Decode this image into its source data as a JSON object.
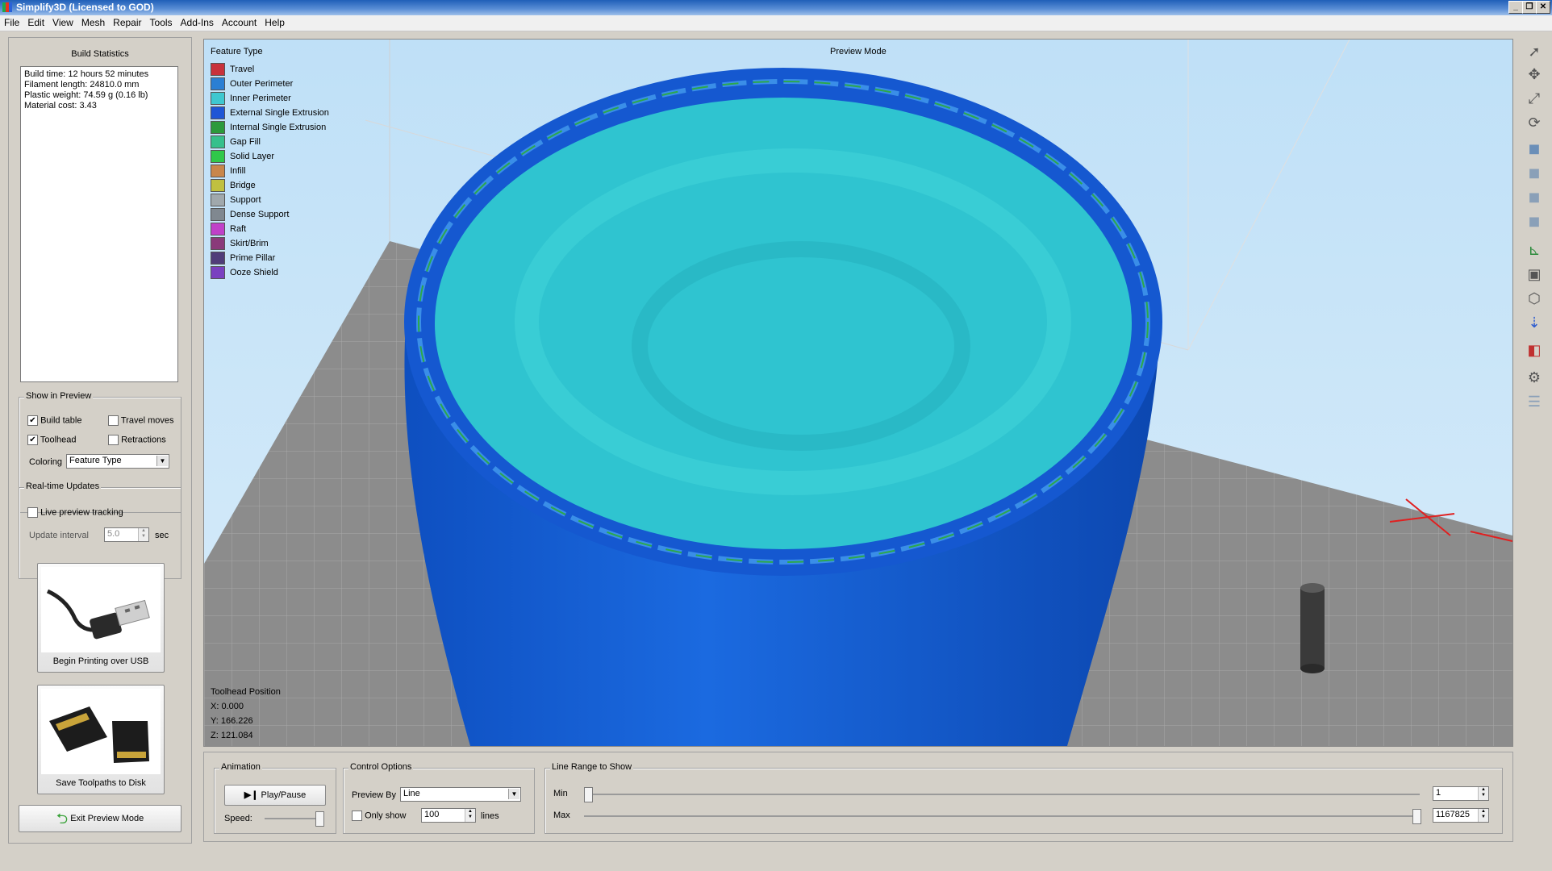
{
  "window": {
    "title": "Simplify3D (Licensed to GOD)"
  },
  "menu": [
    "File",
    "Edit",
    "View",
    "Mesh",
    "Repair",
    "Tools",
    "Add-Ins",
    "Account",
    "Help"
  ],
  "build_statistics": {
    "title": "Build Statistics",
    "lines": [
      "Build time: 12 hours 52 minutes",
      "Filament length: 24810.0 mm",
      "Plastic weight: 74.59 g (0.16 lb)",
      "Material cost: 3.43"
    ]
  },
  "show_in_preview": {
    "title": "Show in Preview",
    "build_table": {
      "label": "Build table",
      "checked": true
    },
    "travel_moves": {
      "label": "Travel moves",
      "checked": false
    },
    "toolhead": {
      "label": "Toolhead",
      "checked": true
    },
    "retractions": {
      "label": "Retractions",
      "checked": false
    },
    "coloring_label": "Coloring",
    "coloring_value": "Feature Type"
  },
  "realtime": {
    "title": "Real-time Updates",
    "live_label": "Live preview tracking",
    "live_checked": false,
    "interval_label": "Update interval",
    "interval_value": "5.0",
    "interval_unit": "sec"
  },
  "actions": {
    "usb_label": "Begin Printing over USB",
    "disk_label": "Save Toolpaths to Disk",
    "exit_label": "Exit Preview Mode"
  },
  "viewport": {
    "mode_title": "Preview Mode",
    "legend_title": "Feature Type",
    "legend": [
      {
        "label": "Travel",
        "color": "#c8323c"
      },
      {
        "label": "Outer Perimeter",
        "color": "#2a7fd4"
      },
      {
        "label": "Inner Perimeter",
        "color": "#3ec8d0"
      },
      {
        "label": "External Single Extrusion",
        "color": "#1e56d6"
      },
      {
        "label": "Internal Single Extrusion",
        "color": "#2c9a3c"
      },
      {
        "label": "Gap Fill",
        "color": "#36c08c"
      },
      {
        "label": "Solid Layer",
        "color": "#30c84a"
      },
      {
        "label": "Infill",
        "color": "#c8864a"
      },
      {
        "label": "Bridge",
        "color": "#c0c040"
      },
      {
        "label": "Support",
        "color": "#a0a8ac"
      },
      {
        "label": "Dense Support",
        "color": "#808890"
      },
      {
        "label": "Raft",
        "color": "#c040c8"
      },
      {
        "label": "Skirt/Brim",
        "color": "#8a3a7a"
      },
      {
        "label": "Prime Pillar",
        "color": "#503c7a"
      },
      {
        "label": "Ooze Shield",
        "color": "#7a40c0"
      }
    ],
    "toolhead_title": "Toolhead Position",
    "toolhead_x": "X: 0.000",
    "toolhead_y": "Y: 166.226",
    "toolhead_z": "Z: 121.084"
  },
  "animation": {
    "title": "Animation",
    "play_label": "Play/Pause",
    "speed_label": "Speed:",
    "speed_fraction": 1.0
  },
  "control_options": {
    "title": "Control Options",
    "preview_by_label": "Preview By",
    "preview_by_value": "Line",
    "only_show_label": "Only show",
    "only_show_value": "100",
    "lines_label": "lines"
  },
  "line_range": {
    "title": "Line Range to Show",
    "min_label": "Min",
    "max_label": "Max",
    "min_value": "1",
    "max_value": "1167825",
    "min_fraction": 0.0,
    "max_fraction": 1.0
  },
  "colors": {
    "vase_outer": "#1363d6",
    "vase_inner": "#33cfd2",
    "build_plate": "#8c8c8c",
    "sky_top": "#bfe0f7"
  }
}
